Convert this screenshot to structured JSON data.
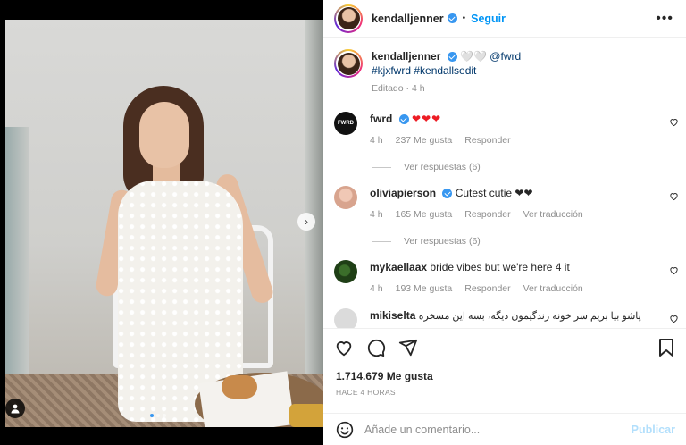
{
  "post": {
    "username": "kendalljenner",
    "follow_label": "Seguir",
    "separator": "•"
  },
  "caption": {
    "username": "kendalljenner",
    "hearts": "🤍🤍",
    "mention": "@fwrd",
    "hashtags": "#kjxfwrd #kendallsedit",
    "meta": "Editado · 4 h"
  },
  "comments": [
    {
      "username": "fwrd",
      "avatar_text": "FWRD",
      "text": "❤❤❤",
      "time": "4 h",
      "likes": "237 Me gusta",
      "reply": "Responder",
      "translate": "",
      "replies_label": "Ver respuestas (6)"
    },
    {
      "username": "oliviapierson",
      "text": "Cutest cutie ❤❤",
      "time": "4 h",
      "likes": "165 Me gusta",
      "reply": "Responder",
      "translate": "Ver traducción",
      "replies_label": "Ver respuestas (6)"
    },
    {
      "username": "mykaellaax",
      "text": "bride vibes but we're here 4 it",
      "time": "4 h",
      "likes": "193 Me gusta",
      "reply": "Responder",
      "translate": "Ver traducción"
    },
    {
      "username": "mikiselta",
      "text": "پاشو بیا بریم سر خونه زندگیمون دیگه، بسه این مسخره"
    }
  ],
  "stats": {
    "likes": "1.714.679 Me gusta",
    "time_ago": "HACE 4 HORAS"
  },
  "composer": {
    "placeholder": "Añade un comentario...",
    "publish_label": "Publicar"
  },
  "colors": {
    "accent": "#0095f6",
    "verified": "#3897f0",
    "heart_red": "#ed1c24"
  },
  "icons": [
    "more-options-icon",
    "verified-icon",
    "heart-icon",
    "comment-icon",
    "share-icon",
    "bookmark-icon",
    "emoji-icon",
    "next-arrow-icon",
    "user-tag-icon"
  ]
}
